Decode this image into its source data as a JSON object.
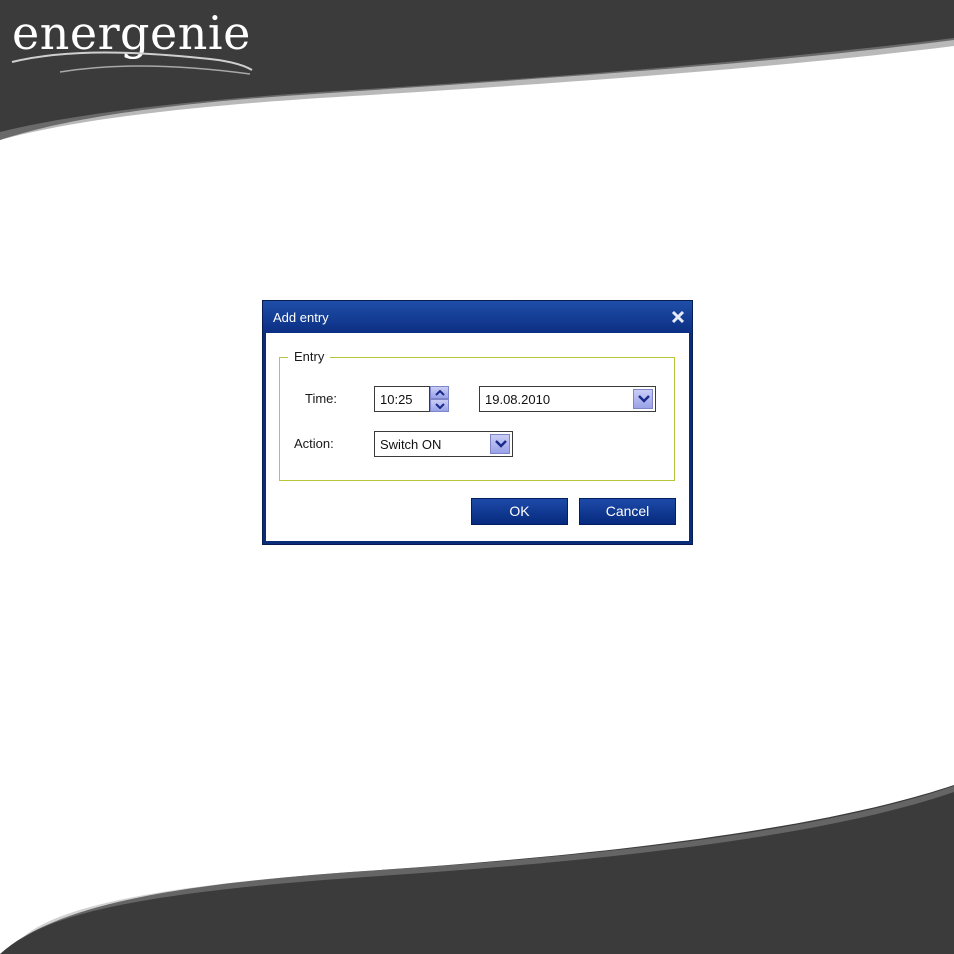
{
  "brand": {
    "logo_text": "energenie"
  },
  "dialog": {
    "title": "Add entry",
    "close_label": "✕",
    "group_label": "Entry",
    "time_label": "Time:",
    "time_value": "10:25",
    "date_value": "19.08.2010",
    "action_label": "Action:",
    "action_value": "Switch ON",
    "ok_label": "OK",
    "cancel_label": "Cancel"
  },
  "colors": {
    "banner": "#3b3b3b",
    "dialog_frame": "#0a2d7a",
    "group_border": "#b8c43a",
    "button": "#0b2f83"
  },
  "icons": {
    "close": "close-icon",
    "spin_up": "chevron-up-icon",
    "spin_down": "chevron-down-icon",
    "dropdown": "chevron-down-icon"
  }
}
